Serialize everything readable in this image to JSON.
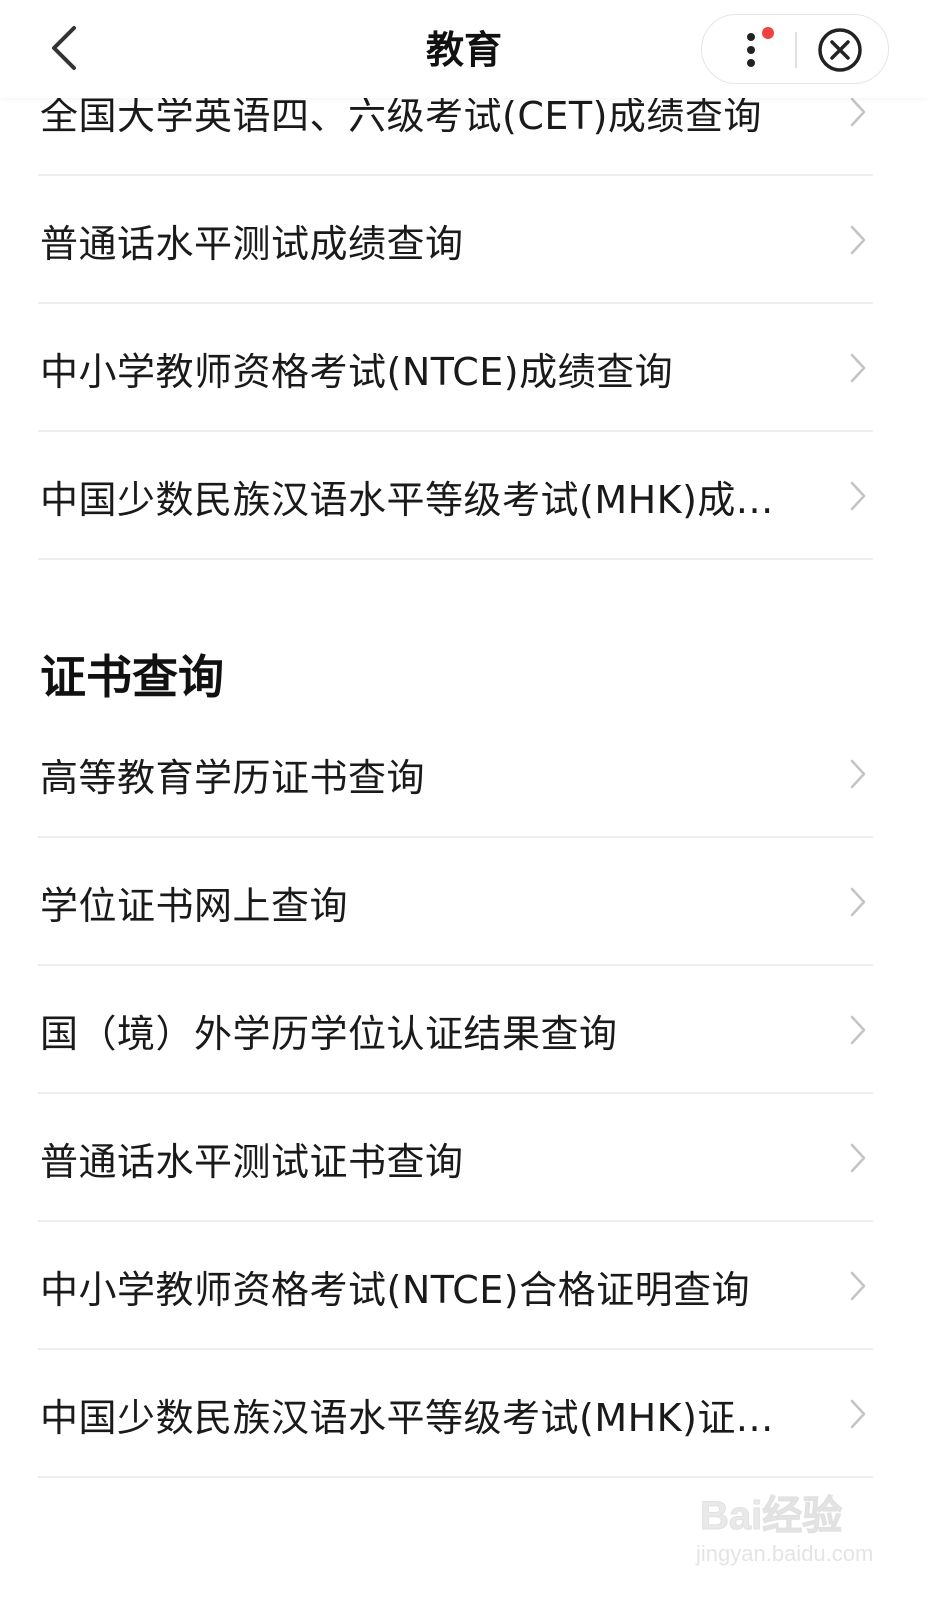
{
  "header": {
    "title": "教育",
    "back_icon": "chevron-left-icon",
    "more_icon": "more-vertical-icon",
    "close_icon": "close-circle-icon",
    "notification_dot_color": "#f04040"
  },
  "score_items": [
    {
      "label": "全国大学英语四、六级考试(CET)成绩查询"
    },
    {
      "label": "普通话水平测试成绩查询"
    },
    {
      "label": "中小学教师资格考试(NTCE)成绩查询"
    },
    {
      "label": "中国少数民族汉语水平等级考试(MHK)成..."
    }
  ],
  "certificate_section": {
    "title": "证书查询",
    "items": [
      {
        "label": "高等教育学历证书查询"
      },
      {
        "label": "学位证书网上查询"
      },
      {
        "label": "国（境）外学历学位认证结果查询"
      },
      {
        "label": "普通话水平测试证书查询"
      },
      {
        "label": "中小学教师资格考试(NTCE)合格证明查询"
      },
      {
        "label": "中国少数民族汉语水平等级考试(MHK)证..."
      }
    ]
  },
  "watermark": {
    "brand": "Bai经验",
    "url": "jingyan.baidu.com"
  },
  "colors": {
    "text": "#1a1a1a",
    "separator": "#eeeeee",
    "chevron": "#c4c4c4",
    "background": "#ffffff"
  }
}
